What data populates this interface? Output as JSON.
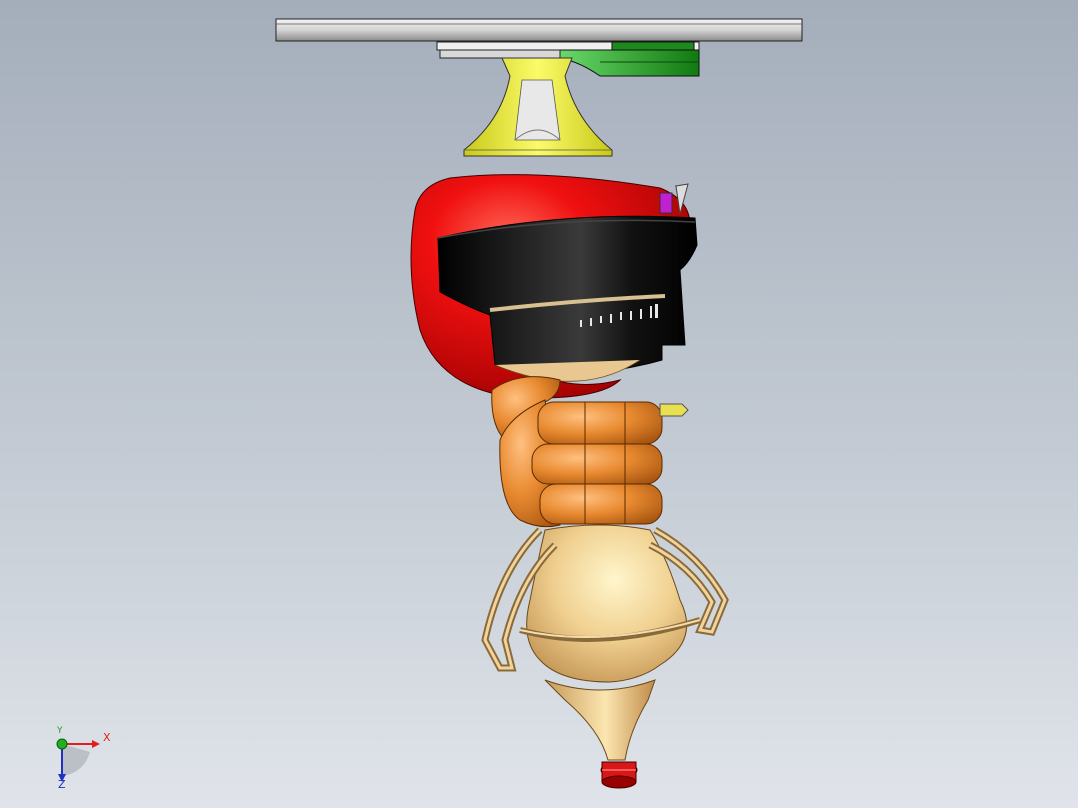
{
  "viewport": {
    "background_top": "#a4aebb",
    "background_bottom": "#e0e4ea"
  },
  "model": {
    "parts": [
      {
        "name": "mounting-flange-plate",
        "color": "#d8d8d8"
      },
      {
        "name": "adapter-plate",
        "color": "#2ea82e"
      },
      {
        "name": "cone-mount",
        "color": "#e8e83a"
      },
      {
        "name": "robot-head-shell",
        "color": "#e01010"
      },
      {
        "name": "black-motor-housing",
        "color": "#111111"
      },
      {
        "name": "fist-hand",
        "color": "#e08a2a"
      },
      {
        "name": "bulb-body",
        "color": "#ecc98a"
      },
      {
        "name": "red-tip-ring",
        "color": "#d81818"
      }
    ]
  },
  "triad": {
    "x_label": "X",
    "y_label": "Y",
    "z_label": "Z",
    "x_color": "#e02020",
    "y_color": "#20a020",
    "z_color": "#2030c0"
  }
}
